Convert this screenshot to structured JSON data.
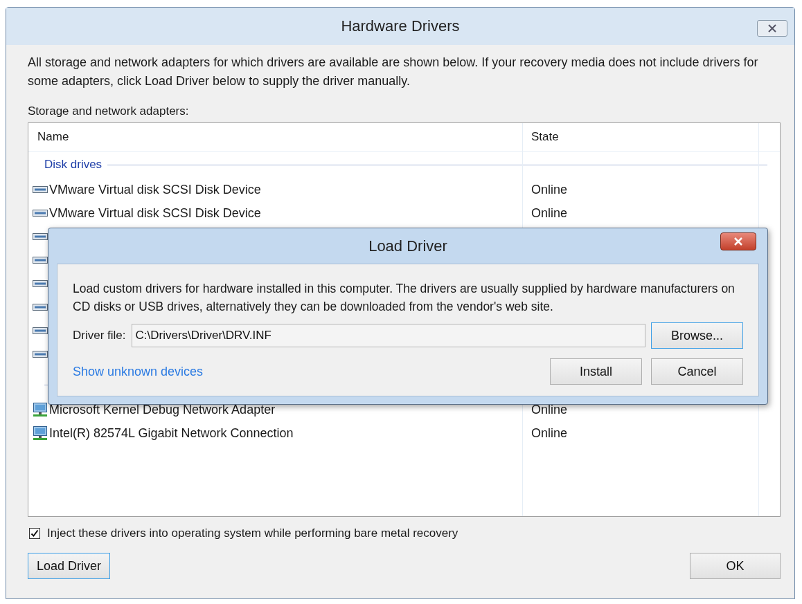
{
  "window": {
    "title": "Hardware Drivers"
  },
  "description": "All storage and network adapters for which drivers are available are shown below. If your recovery media does not include drivers for some adapters, click Load Driver below to supply the driver manually.",
  "list_label": "Storage and network adapters:",
  "table": {
    "columns": [
      "Name",
      "State"
    ],
    "groups": [
      {
        "label": "Disk drives",
        "rows": [
          {
            "kind": "disk",
            "name": "VMware Virtual disk SCSI Disk Device",
            "state": "Online"
          },
          {
            "kind": "disk",
            "name": "VMware Virtual disk SCSI Disk Device",
            "state": "Online"
          },
          {
            "kind": "disk"
          },
          {
            "kind": "disk"
          },
          {
            "kind": "disk"
          },
          {
            "kind": "disk"
          },
          {
            "kind": "disk"
          },
          {
            "kind": "disk"
          }
        ]
      },
      {
        "rows": [
          {
            "kind": "network",
            "name": "Microsoft Kernel Debug Network Adapter",
            "state": "Online"
          },
          {
            "kind": "network",
            "name": "Intel(R) 82574L Gigabit Network Connection",
            "state": "Online"
          }
        ]
      }
    ]
  },
  "inject_checkbox": {
    "label": "Inject these drivers into operating system while performing bare metal recovery",
    "checked": true
  },
  "buttons": {
    "load_driver": "Load Driver",
    "ok": "OK"
  },
  "dialog": {
    "title": "Load Driver",
    "description": "Load custom drivers for hardware installed in this computer. The drivers are usually supplied by hardware manufacturers on CD disks or USB drives, alternatively they can be downloaded from the vendor's web site.",
    "field_label": "Driver file:",
    "field_value": "C:\\Drivers\\Driver\\DRV.INF",
    "browse": "Browse...",
    "link": "Show unknown devices",
    "install": "Install",
    "cancel": "Cancel"
  }
}
